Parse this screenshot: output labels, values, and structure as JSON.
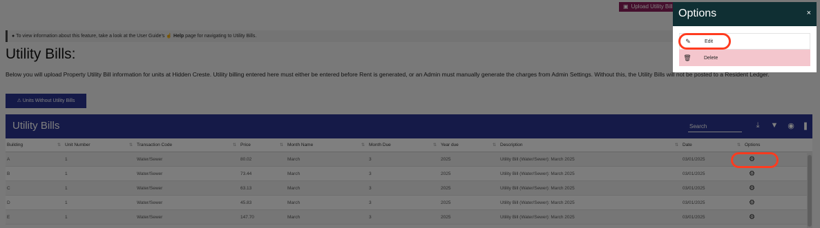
{
  "toolbar": {
    "upload_label": "Upload Utility Bills"
  },
  "info": {
    "prefix": "To view information about this feature, take a look at the User Guide's",
    "help": "Help",
    "suffix": "page for navigating to Utility Bills."
  },
  "page_title": "Utility Bills:",
  "description": "Below you will upload Property Utility Bill information for units at Hidden Creste. Utility billing entered here must either be entered before Rent is generated, or an Admin must manually generate the charges from Admin Settings. Without this, the Utility Bills will not be posted to a Resident Ledger.",
  "units_button": "Units Without Utility Bills",
  "table": {
    "title": "Utility Bills",
    "search_placeholder": "Search",
    "columns": [
      "Building",
      "Unit Number",
      "Transaction Code",
      "Price",
      "Month Name",
      "Month Due",
      "Year due",
      "Description",
      "Date",
      "Options"
    ],
    "rows": [
      [
        "A",
        "1",
        "Water/Sewer",
        "80.02",
        "March",
        "3",
        "2025",
        "Utility Bill (Water/Sewer): March 2025",
        "03/01/2025"
      ],
      [
        "B",
        "1",
        "Water/Sewer",
        "73.44",
        "March",
        "3",
        "2025",
        "Utility Bill (Water/Sewer): March 2025",
        "03/01/2025"
      ],
      [
        "C",
        "1",
        "Water/Sewer",
        "63.13",
        "March",
        "3",
        "2025",
        "Utility Bill (Water/Sewer): March 2025",
        "03/01/2025"
      ],
      [
        "D",
        "1",
        "Water/Sewer",
        "45.83",
        "March",
        "3",
        "2025",
        "Utility Bill (Water/Sewer): March 2025",
        "03/01/2025"
      ],
      [
        "E",
        "1",
        "Water/Sewer",
        "147.70",
        "March",
        "3",
        "2025",
        "Utility Bill (Water/Sewer): March 2025",
        "03/01/2025"
      ]
    ]
  },
  "options_panel": {
    "title": "Options",
    "close": "×",
    "items": [
      {
        "label": "Edit",
        "icon": "edit-icon"
      },
      {
        "label": "Delete",
        "icon": "trash-icon"
      }
    ]
  },
  "colors": {
    "header": "#2b3590",
    "panel_head": "#0f2f33",
    "delete_bg": "#f4c6cd",
    "highlight_ring": "#ff3b1f",
    "upload_button": "#8a1f5a"
  }
}
